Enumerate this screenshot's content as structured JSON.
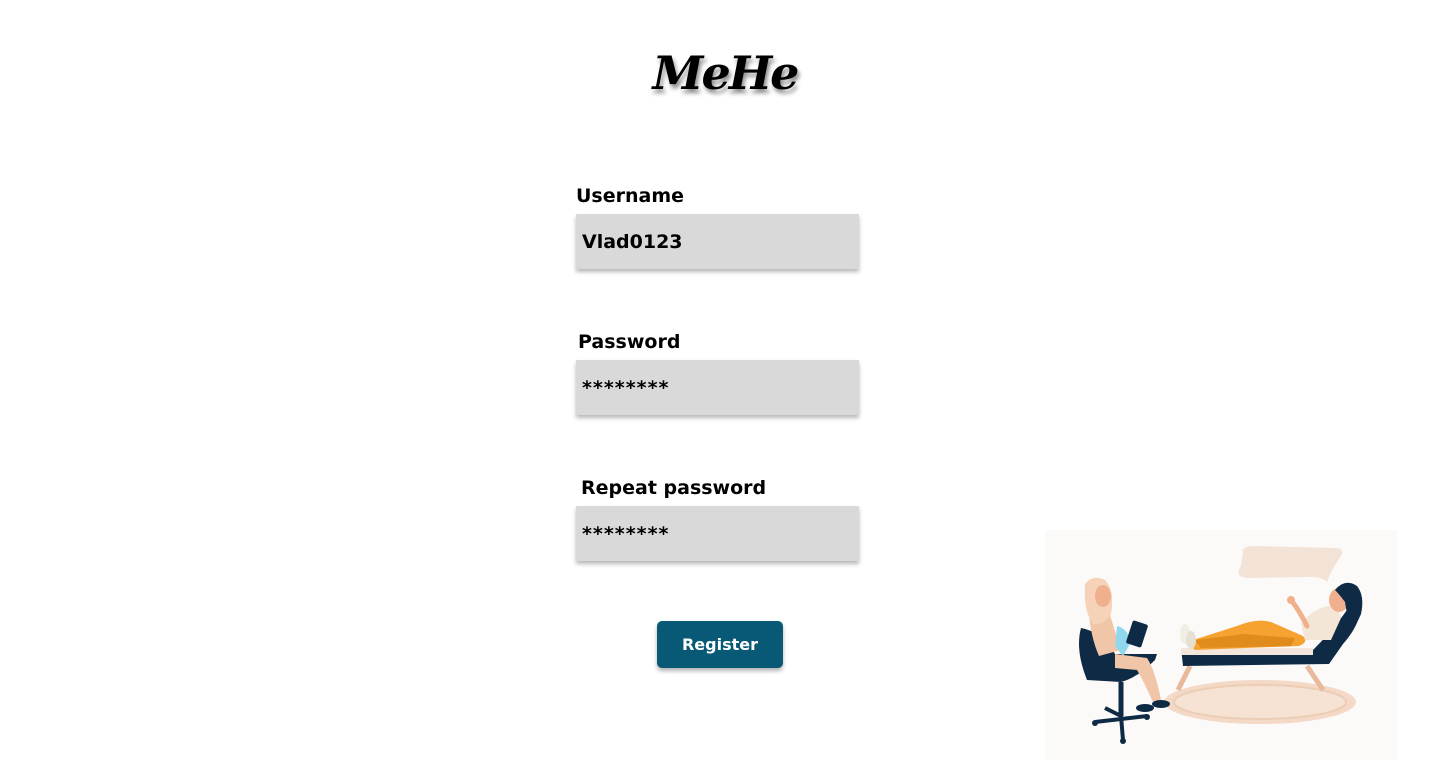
{
  "app": {
    "logo_text": "MeHe"
  },
  "form": {
    "username_label": "Username",
    "username_value": "Vlad0123",
    "password_label": "Password",
    "password_value": "********",
    "repeat_password_label": "Repeat password",
    "repeat_password_value": "********",
    "register_label": "Register"
  },
  "colors": {
    "accent": "#075975",
    "input_background": "#d9d9d9",
    "page_background": "#ffffff"
  },
  "illustration": {
    "icon": "therapy-session-illustration"
  }
}
